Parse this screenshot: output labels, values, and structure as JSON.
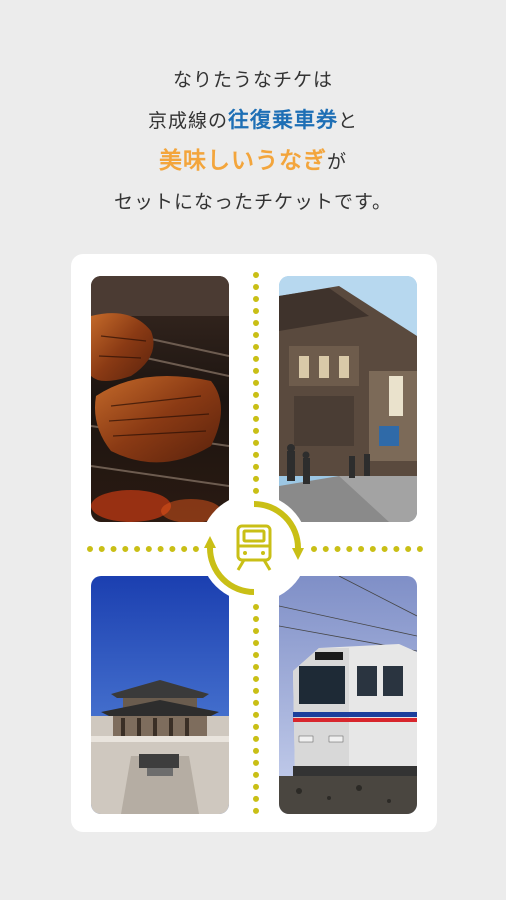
{
  "headline": {
    "line1": "なりたうなチケは",
    "line2_prefix": "京成線の",
    "line2_accent": "往復乗車券",
    "line2_suffix": "と",
    "line3_accent": "美味しいうなぎ",
    "line3_suffix": "が",
    "line4": "セットになったチケットです。"
  },
  "colors": {
    "accent_blue": "#1e6fb5",
    "accent_orange": "#f3a53c",
    "dot_yellow": "#c9bf16",
    "background": "#ececec"
  },
  "icons": {
    "center": "train-cycle-icon"
  }
}
